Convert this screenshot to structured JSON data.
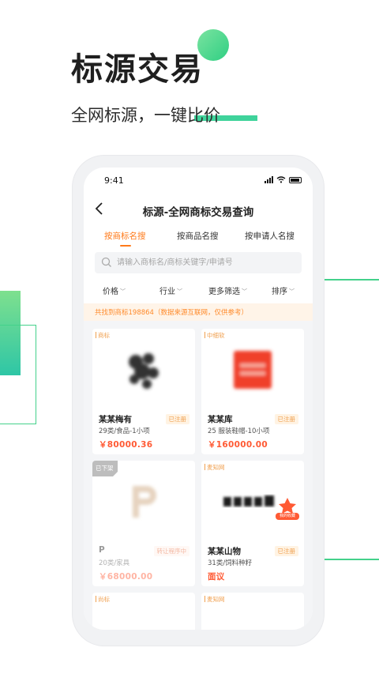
{
  "hero": {
    "title": "标源交易",
    "subtitle": "全网标源，一键比价"
  },
  "status_bar": {
    "time": "9:41"
  },
  "nav": {
    "title": "标源-全网商标交易查询"
  },
  "tabs": [
    {
      "label": "按商标名搜",
      "active": true
    },
    {
      "label": "按商品名搜",
      "active": false
    },
    {
      "label": "按申请人名搜",
      "active": false
    }
  ],
  "search": {
    "placeholder": "请输入商标名/商标关键字/申请号",
    "value": ""
  },
  "filters": [
    {
      "label": "价格"
    },
    {
      "label": "行业"
    },
    {
      "label": "更多筛选"
    },
    {
      "label": "排序"
    }
  ],
  "result_text": "共找到商标198864（数据来源互联网，仅供参考）",
  "cards": [
    {
      "source": "商标",
      "name": "某某梅有",
      "status": "已注册",
      "category": "29类/食品-1小项",
      "price": "￥80000.36"
    },
    {
      "source": "中细软",
      "name": "某某库",
      "status": "已注册",
      "category": "25 服装鞋帽-10小项",
      "price": "￥160000.00"
    },
    {
      "source": "",
      "offline_label": "已下架",
      "name": "P",
      "status": "转让程序中",
      "category": "20类/家具",
      "price": "￥68000.00"
    },
    {
      "source": "麦知网",
      "name": "某某山物",
      "status": "已注册",
      "category": "31类/饲料种籽",
      "price": "面议",
      "fav_label": "我的收藏"
    },
    {
      "source": "尚标"
    },
    {
      "source": "麦知网"
    }
  ],
  "colors": {
    "accent": "#ff7a1a",
    "price": "#ff5a34",
    "brand_green": "#2fcf83"
  }
}
